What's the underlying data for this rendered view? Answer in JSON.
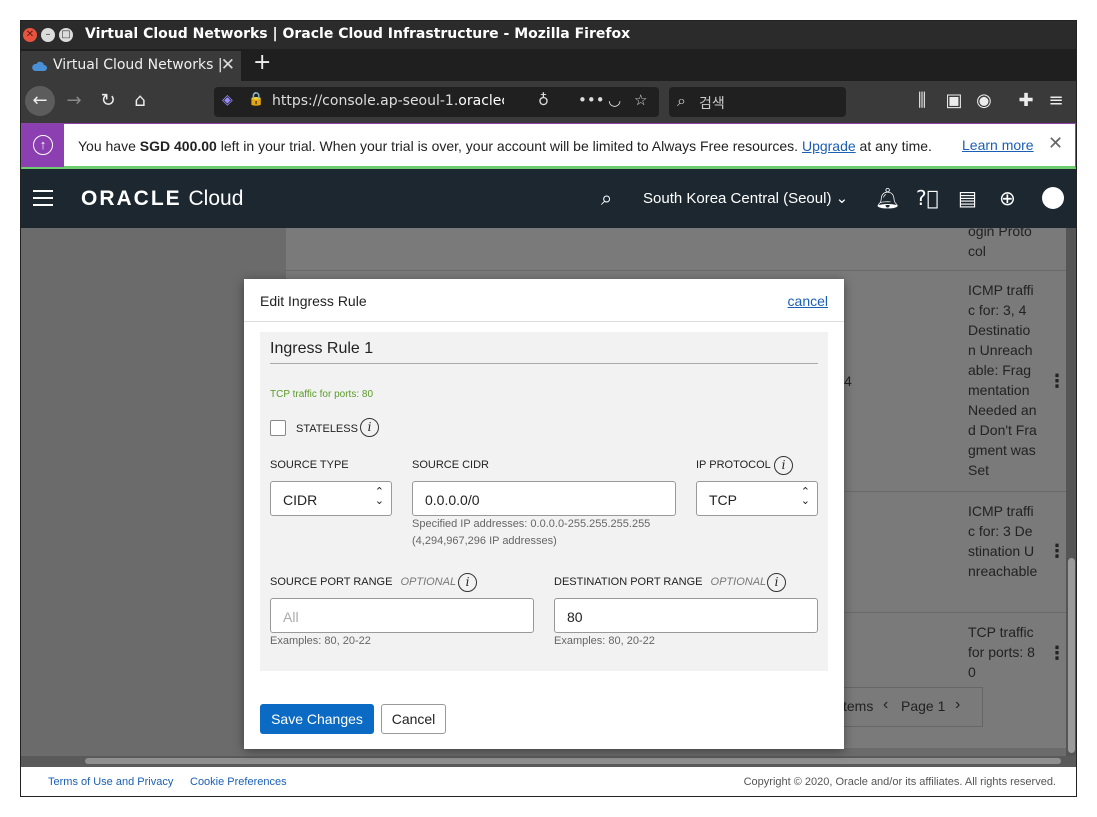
{
  "window": {
    "title": "Virtual Cloud Networks | Oracle Cloud Infrastructure - Mozilla Firefox"
  },
  "tab": {
    "label": "Virtual Cloud Networks |",
    "close": "✕",
    "new": "+"
  },
  "navbar": {
    "url_prefix": "https://console.ap-seoul-1.",
    "url_domain": "oraclecl",
    "search_placeholder": "검색"
  },
  "trial": {
    "text_before": "You have ",
    "amount": "SGD 400.00",
    "text_after": " left in your trial. When your trial is over, your account will be limited to Always Free resources. ",
    "upgrade": "Upgrade",
    "text_end": " at any time.",
    "learn_more": "Learn more"
  },
  "header": {
    "logo_bold": "ORACLE",
    "logo_light": "Cloud",
    "region": "South Korea Central (Seoul)"
  },
  "table": {
    "rows": [
      {
        "desc": "ogin Proto col"
      },
      {
        "desc": "ICMP traffic for: 3, 4 Destination Unreachable: Fragmentation Needed and Don't Fragment was Set",
        "col_fragment": "4"
      },
      {
        "desc": "ICMP traffic for: 3 Destination Unreachable"
      },
      {
        "desc": "TCP traffic for ports: 80"
      }
    ],
    "pager_items": "tems",
    "pager_page": "Page 1"
  },
  "modal": {
    "title": "Edit Ingress Rule",
    "cancel": "cancel",
    "rule_title": "Ingress Rule 1",
    "hint": "TCP traffic for ports: 80",
    "stateless_label": "STATELESS",
    "source_type_label": "SOURCE TYPE",
    "source_type_value": "CIDR",
    "source_cidr_label": "SOURCE CIDR",
    "source_cidr_value": "0.0.0.0/0",
    "source_cidr_help_1": "Specified IP addresses: 0.0.0.0-255.255.255.255",
    "source_cidr_help_2": "(4,294,967,296 IP addresses)",
    "ip_protocol_label": "IP PROTOCOL",
    "ip_protocol_value": "TCP",
    "source_port_label": "SOURCE PORT RANGE",
    "source_port_optional": "OPTIONAL",
    "source_port_placeholder": "All",
    "source_port_help": "Examples: 80, 20-22",
    "dest_port_label": "DESTINATION PORT RANGE",
    "dest_port_optional": "OPTIONAL",
    "dest_port_value": "80",
    "dest_port_help": "Examples: 80, 20-22",
    "save": "Save Changes",
    "cancel_button": "Cancel"
  },
  "footer": {
    "terms": "Terms of Use and Privacy",
    "cookies": "Cookie Preferences",
    "copyright": "Copyright © 2020, Oracle and/or its affiliates. All rights reserved."
  },
  "colors": {
    "accent": "#0b6bc4",
    "header": "#1c2730",
    "trial": "#8b3fb0"
  }
}
